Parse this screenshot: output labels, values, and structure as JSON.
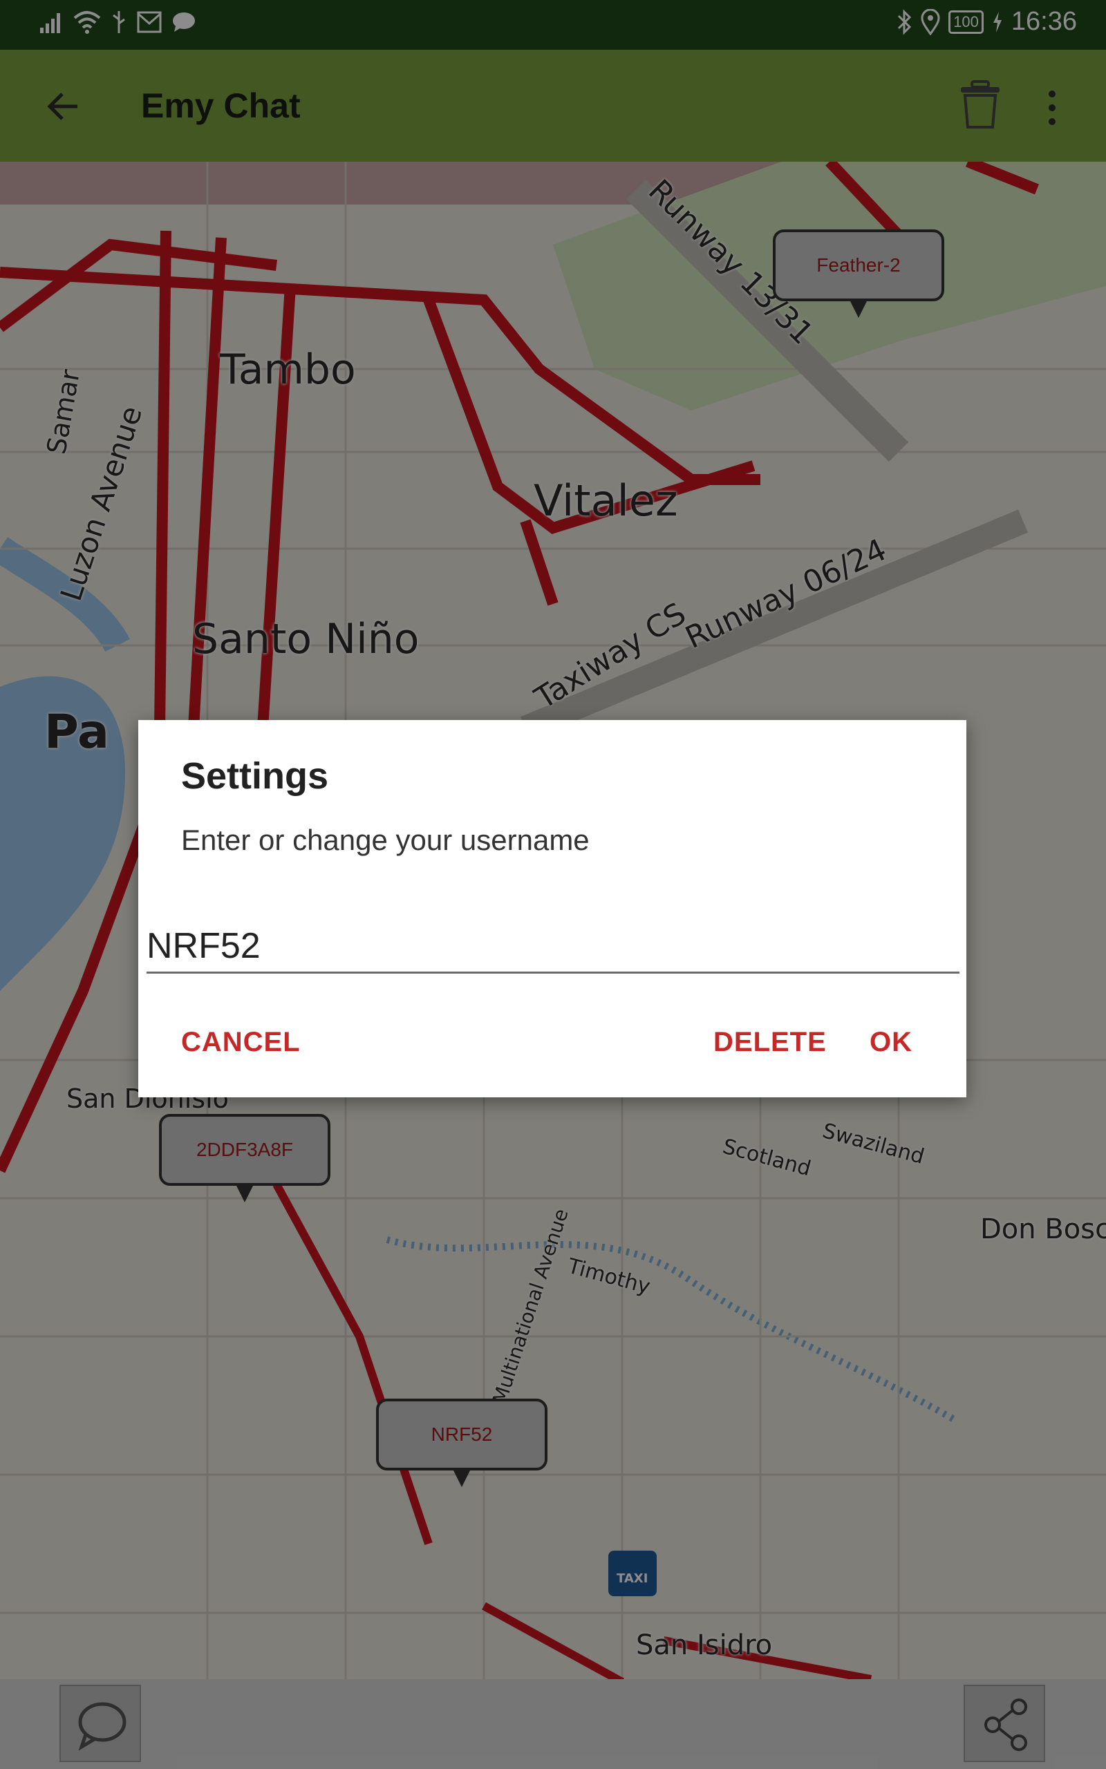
{
  "status_bar": {
    "time": "16:36",
    "battery": "100",
    "icons_left": [
      "signal-icon",
      "wifi-icon",
      "usb-icon",
      "gmail-icon",
      "message-icon"
    ],
    "icons_right": [
      "bluetooth-icon",
      "location-icon",
      "battery-icon",
      "charging-icon"
    ]
  },
  "app_bar": {
    "title": "Emy Chat",
    "background": "#7b9e3f",
    "icons": [
      "back-arrow-icon",
      "trash-icon",
      "more-vert-icon"
    ]
  },
  "map": {
    "place_labels": [
      "Tambo",
      "Vitalez",
      "Santo Niño",
      "Pa",
      "San Dionisio",
      "Don Bosc",
      "San Isidro",
      "Runway 13/31",
      "Runway 06/24",
      "Taxiway CS",
      "Luzon Avenue",
      "Samar",
      "Scotland",
      "Swaziland",
      "Timothy",
      "Multinational Avenue"
    ],
    "markers": [
      {
        "label": "Feather-2"
      },
      {
        "label": "2DDF3A8F"
      },
      {
        "label": "NRF52"
      }
    ],
    "taxi_label": "TAXI"
  },
  "dialog": {
    "title": "Settings",
    "message": "Enter or change your username",
    "username_value": "NRF52",
    "cancel_label": "CANCEL",
    "delete_label": "DELETE",
    "ok_label": "OK",
    "accent": "#c62828"
  },
  "bottom_bar": {
    "icons": [
      "chat-bubble-icon",
      "share-icon"
    ]
  }
}
